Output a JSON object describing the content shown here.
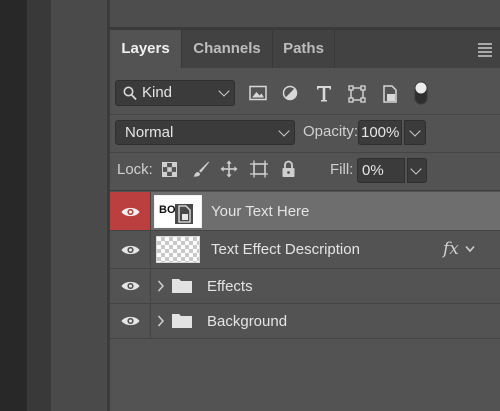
{
  "tabs": [
    {
      "label": "Layers",
      "active": true
    },
    {
      "label": "Channels",
      "active": false
    },
    {
      "label": "Paths",
      "active": false
    }
  ],
  "filter": {
    "kind_label": "Kind",
    "icons": [
      "image-filter-icon",
      "adjustment-filter-icon",
      "type-filter-icon",
      "shape-filter-icon",
      "smart-object-filter-icon",
      "filter-toggle-icon"
    ]
  },
  "blend": {
    "mode": "Normal",
    "opacity_label": "Opacity:",
    "opacity_value": "100%"
  },
  "lock": {
    "label": "Lock:",
    "icons": [
      "lock-transparent-pixels-icon",
      "lock-image-pixels-icon",
      "lock-position-icon",
      "lock-artboard-icon",
      "lock-all-icon"
    ],
    "fill_label": "Fill:",
    "fill_value": "0%"
  },
  "layers": [
    {
      "name": "Your Text Here",
      "type": "smart-object",
      "selected": true,
      "visible": true,
      "thumb_text": "BO"
    },
    {
      "name": "Text Effect Description",
      "type": "pixel",
      "selected": false,
      "visible": true,
      "fx": "fx"
    },
    {
      "name": "Effects",
      "type": "group",
      "selected": false,
      "visible": true
    },
    {
      "name": "Background",
      "type": "group",
      "selected": false,
      "visible": true
    }
  ],
  "colors": {
    "panel_bg": "#535353",
    "selected_row": "#6e6e6e",
    "visibility_highlight": "#bc3f3f"
  }
}
